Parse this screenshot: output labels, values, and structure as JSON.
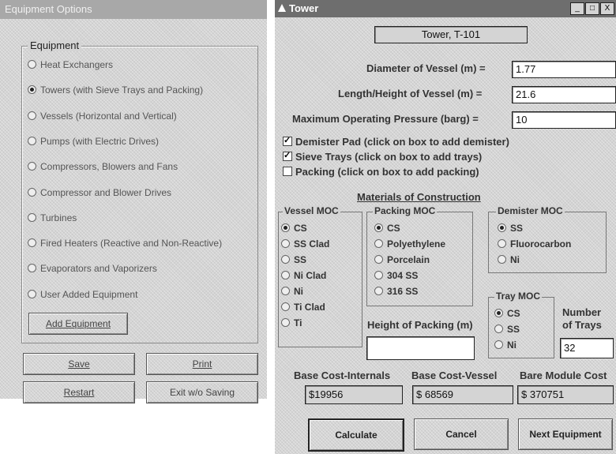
{
  "left_window": {
    "title": "Equipment Options",
    "group_title": "Equipment",
    "options": [
      {
        "label": "Heat Exchangers",
        "selected": false
      },
      {
        "label": "Towers (with Sieve Trays and Packing)",
        "selected": true
      },
      {
        "label": "Vessels (Horizontal and Vertical)",
        "selected": false
      },
      {
        "label": "Pumps (with Electric Drives)",
        "selected": false
      },
      {
        "label": "Compressors, Blowers and Fans",
        "selected": false
      },
      {
        "label": "Compressor and Blower Drives",
        "selected": false
      },
      {
        "label": "Turbines",
        "selected": false
      },
      {
        "label": "Fired Heaters (Reactive and Non-Reactive)",
        "selected": false
      },
      {
        "label": "Evaporators and Vaporizers",
        "selected": false
      },
      {
        "label": "User Added Equipment",
        "selected": false
      }
    ],
    "add_equipment": "Add Equipment",
    "save": "Save",
    "print": "Print",
    "restart": "Restart",
    "exit": "Exit w/o Saving"
  },
  "right_window": {
    "title": "Tower",
    "window_buttons": {
      "minimize": "_",
      "maximize": "□",
      "close": "X"
    },
    "name_field": "Tower, T-101",
    "diameter": {
      "label": "Diameter of Vessel (m) =",
      "value": "1.77"
    },
    "length": {
      "label": "Length/Height of Vessel (m) =",
      "value": "21.6"
    },
    "pressure": {
      "label": "Maximum Operating Pressure (barg)  =",
      "value": "10"
    },
    "checkboxes": [
      {
        "label": "Demister Pad (click on box to add demister)",
        "checked": true
      },
      {
        "label": "Sieve Trays (click on box to add trays)",
        "checked": true
      },
      {
        "label": "Packing (click on box to add packing)",
        "checked": false
      }
    ],
    "moc_heading": "Materials of Construction",
    "vessel_moc": {
      "title": "Vessel MOC",
      "options": [
        "CS",
        "SS Clad",
        "SS",
        "Ni Clad",
        "Ni",
        "Ti Clad",
        "Ti"
      ],
      "selected": 0
    },
    "packing_moc": {
      "title": "Packing MOC",
      "options": [
        "CS",
        "Polyethylene",
        "Porcelain",
        "304 SS",
        "316 SS"
      ],
      "selected": 0
    },
    "demister_moc": {
      "title": "Demister MOC",
      "options": [
        "SS",
        "Fluorocarbon",
        "Ni"
      ],
      "selected": 0
    },
    "tray_moc": {
      "title": "Tray MOC",
      "options": [
        "CS",
        "SS",
        "Ni"
      ],
      "selected": 0
    },
    "height_of_packing": {
      "label": "Height of Packing (m)",
      "value": ""
    },
    "number_of_trays": {
      "label_line1": "Number",
      "label_line2": "of Trays",
      "value": "32"
    },
    "costs": {
      "internals": {
        "label": "Base Cost-Internals",
        "value": "$19956"
      },
      "vessel": {
        "label": "Base Cost-Vessel",
        "value": "$ 68569"
      },
      "bare_module": {
        "label": "Bare Module Cost",
        "value": "$ 370751"
      }
    },
    "buttons": {
      "calculate": "Calculate",
      "cancel": "Cancel",
      "next": "Next Equipment"
    }
  }
}
